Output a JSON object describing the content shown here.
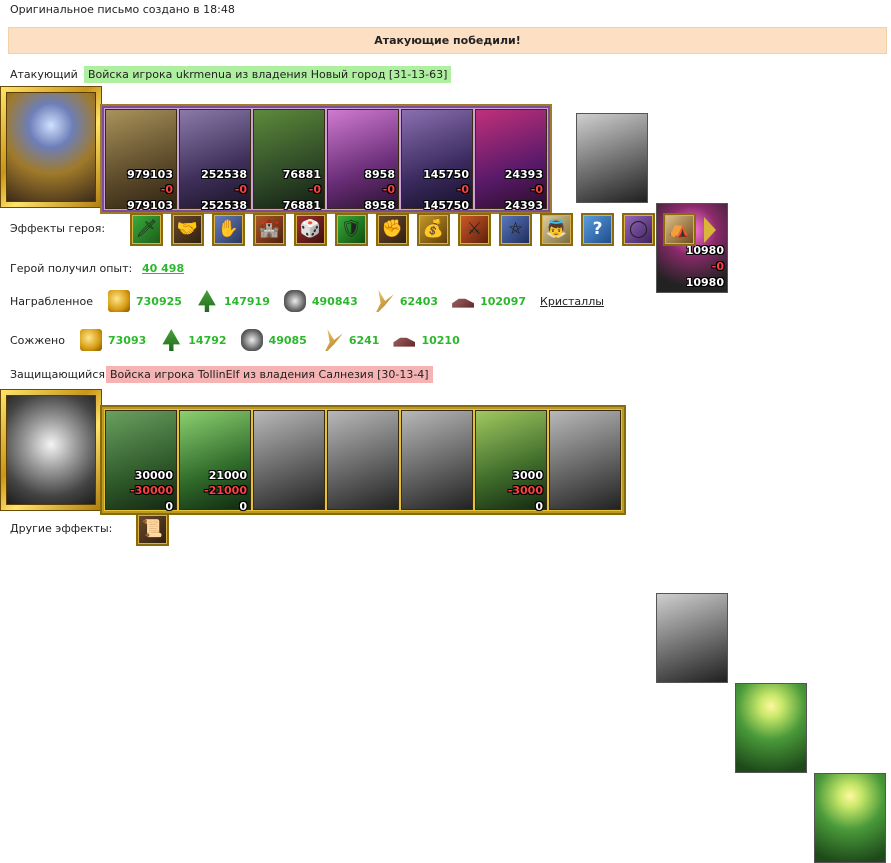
{
  "header": {
    "created_text": "Оригинальное письмо создано в 18:48",
    "result_banner": "Атакующие победили!"
  },
  "attacker": {
    "label": "Атакующий",
    "army_desc": "Войска игрока ukrmenua из владения Новый город [31-13-63]",
    "units": [
      {
        "count": "979103",
        "loss": "-0",
        "remain": "979103"
      },
      {
        "count": "252538",
        "loss": "-0",
        "remain": "252538"
      },
      {
        "count": "76881",
        "loss": "-0",
        "remain": "76881"
      },
      {
        "count": "8958",
        "loss": "-0",
        "remain": "8958"
      },
      {
        "count": "145750",
        "loss": "-0",
        "remain": "145750"
      },
      {
        "count": "24393",
        "loss": "-0",
        "remain": "24393"
      }
    ],
    "extra_units": [
      {
        "count": "",
        "loss": "",
        "remain": ""
      },
      {
        "count": "10980",
        "loss": "-0",
        "remain": "10980"
      }
    ]
  },
  "hero_effects": {
    "label": "Эффекты героя:",
    "icons": [
      "sword-icon",
      "handshake-sword-icon",
      "hand-icon",
      "fortress-icon",
      "dice-icon",
      "shield-icon",
      "hand-shield-icon",
      "gold-bag-icon",
      "armor-icon",
      "pentagram-icon",
      "angel-icon",
      "question-icon",
      "ring-icon",
      "tent-icon"
    ]
  },
  "experience": {
    "label": "Герой получил опыт:",
    "value": "40 498"
  },
  "rewarded": {
    "label": "Награбленное",
    "gold": "730925",
    "wood": "147919",
    "ore": "490843",
    "wheat": "62403",
    "gems": "102097",
    "crystals_link": "Кристаллы"
  },
  "burned": {
    "label": "Сожжено",
    "gold": "73093",
    "wood": "14792",
    "ore": "49085",
    "wheat": "6241",
    "gems": "10210"
  },
  "defender": {
    "label": "Защищающийся",
    "army_desc": "Войска игрока TollinElf из владения Салнезия [30-13-4]",
    "units": [
      {
        "count": "30000",
        "loss": "-30000",
        "remain": "0"
      },
      {
        "count": "21000",
        "loss": "-21000",
        "remain": "0"
      },
      {
        "count": "",
        "loss": "",
        "remain": ""
      },
      {
        "count": "",
        "loss": "",
        "remain": ""
      },
      {
        "count": "",
        "loss": "",
        "remain": ""
      },
      {
        "count": "3000",
        "loss": "-3000",
        "remain": "0"
      },
      {
        "count": "",
        "loss": "",
        "remain": ""
      }
    ]
  },
  "other_effects": {
    "label": "Другие эффекты:"
  }
}
